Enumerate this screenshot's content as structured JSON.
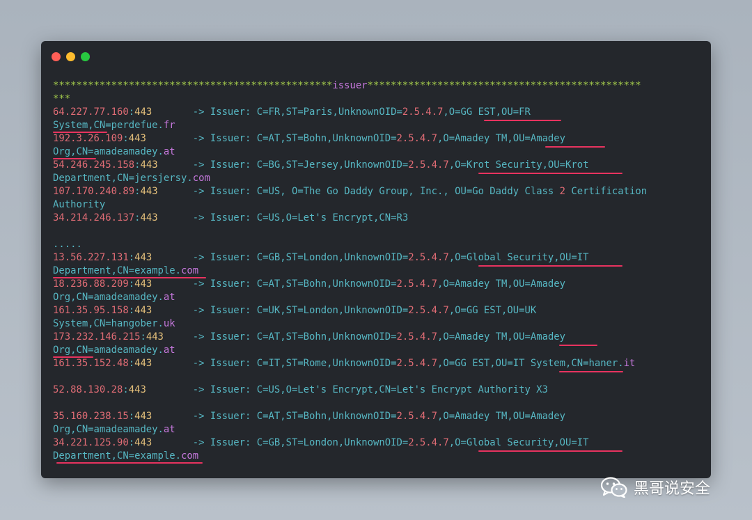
{
  "window": {
    "buttons": [
      "close",
      "minimize",
      "maximize"
    ]
  },
  "terminal": {
    "header": {
      "line1_left": "************************************************",
      "label": "issuer",
      "line1_right": "***********************************************",
      "line2": "***"
    },
    "ellipsis": ".....",
    "arrow": "->",
    "issuer_label": "Issuer:",
    "entries": [
      {
        "ip": "64.227.77.160",
        "port": "443",
        "line1": "C=FR,ST=Paris,UnknownOID=2.5.4.7,O=GG EST,OU=FR",
        "line2": "System,CN=perdefue.fr"
      },
      {
        "ip": "192.3.26.109",
        "port": "443",
        "line1": "C=AT,ST=Bohn,UnknownOID=2.5.4.7,O=Amadey TM,OU=Amadey",
        "line2": "Org,CN=amadeamadey.at"
      },
      {
        "ip": "54.246.245.158",
        "port": "443",
        "line1": "C=BG,ST=Jersey,UnknownOID=2.5.4.7,O=Krot Security,OU=Krot",
        "line2": "Department,CN=jersjersy.com"
      },
      {
        "ip": "107.170.240.89",
        "port": "443",
        "line1": "C=US, O=The Go Daddy Group, Inc., OU=Go Daddy Class 2 Certification",
        "line2": "Authority"
      },
      {
        "ip": "34.214.246.137",
        "port": "443",
        "line1": "C=US,O=Let's Encrypt,CN=R3"
      },
      {
        "ip": "13.56.227.131",
        "port": "443",
        "line1": "C=GB,ST=London,UnknownOID=2.5.4.7,O=Global Security,OU=IT",
        "line2": "Department,CN=example.com"
      },
      {
        "ip": "18.236.88.209",
        "port": "443",
        "line1": "C=AT,ST=Bohn,UnknownOID=2.5.4.7,O=Amadey TM,OU=Amadey",
        "line2": "Org,CN=amadeamadey.at"
      },
      {
        "ip": "161.35.95.158",
        "port": "443",
        "line1": "C=UK,ST=London,UnknownOID=2.5.4.7,O=GG EST,OU=UK",
        "line2": "System,CN=hangober.uk"
      },
      {
        "ip": "173.232.146.215",
        "port": "443",
        "line1": "C=AT,ST=Bohn,UnknownOID=2.5.4.7,O=Amadey TM,OU=Amadey",
        "line2": "Org,CN=amadeamadey.at"
      },
      {
        "ip": "161.35.152.48",
        "port": "443",
        "line1": "C=IT,ST=Rome,UnknownOID=2.5.4.7,O=GG EST,OU=IT System,CN=haner.it"
      },
      {
        "ip": "52.88.130.28",
        "port": "443",
        "line1": "C=US,O=Let's Encrypt,CN=Let's Encrypt Authority X3"
      },
      {
        "ip": "35.160.238.15",
        "port": "443",
        "line1": "C=AT,ST=Bohn,UnknownOID=2.5.4.7,O=Amadey TM,OU=Amadey",
        "line2": "Org,CN=amadeamadey.at"
      },
      {
        "ip": "34.221.125.90",
        "port": "443",
        "line1": "C=GB,ST=London,UnknownOID=2.5.4.7,O=Global Security,OU=IT",
        "line2": "Department,CN=example.com"
      }
    ]
  },
  "watermark": {
    "icon": "wechat-icon",
    "text": "黑哥说安全"
  },
  "colors": {
    "background": "#24272c",
    "ip": "#e06c75",
    "port": "#e5c07b",
    "text": "#56b6c2",
    "stars": "#a2c94b",
    "highlight_underline": "#e8335f"
  }
}
